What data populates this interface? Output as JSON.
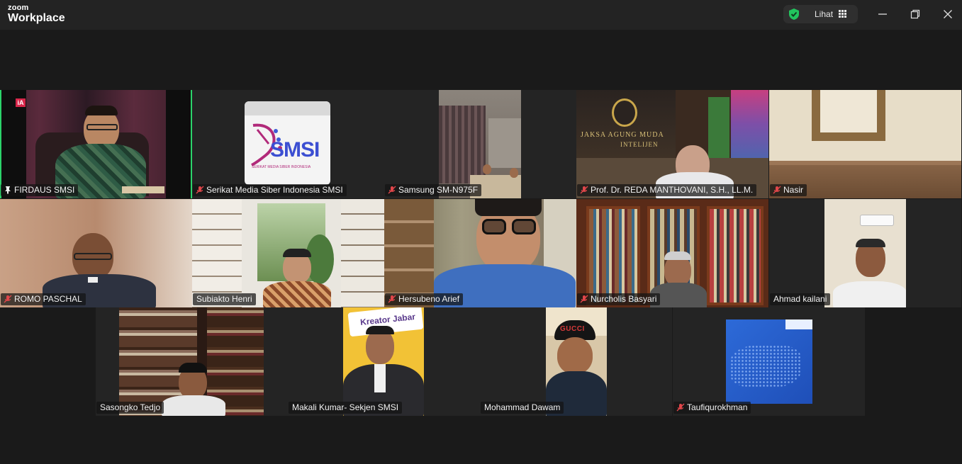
{
  "app": {
    "brand_top": "zoom",
    "brand_bottom": "Workplace"
  },
  "header": {
    "view_label": "Lihat",
    "icons": [
      "shield-check-icon",
      "grid-view-icon",
      "minimize-icon",
      "restore-icon",
      "close-icon"
    ]
  },
  "colors": {
    "active_border": "#2bd36a",
    "muted_mic": "#e0464a",
    "shield": "#22c55e",
    "background": "#1a1a1a"
  },
  "participants": [
    {
      "name": "FIRDAUS SMSI",
      "badge": "pin-icon",
      "active": true
    },
    {
      "name": "Serikat Media Siber Indonesia SMSI",
      "badge": "mic-muted-icon",
      "logo_main": "SMSI",
      "logo_sub": "SERIKAT MEDIA SIBER INDONESIA"
    },
    {
      "name": "Samsung SM-N975F",
      "badge": "mic-muted-icon"
    },
    {
      "name": "Prof. Dr. REDA MANTHOVANI, S.H., LL.M.",
      "badge": "mic-muted-icon",
      "wall_text_1": "JAKSA AGUNG MUDA",
      "wall_text_2": "INTELIJEN"
    },
    {
      "name": "Nasir",
      "badge": "mic-muted-icon"
    },
    {
      "name": "ROMO PASCHAL",
      "badge": "mic-muted-icon"
    },
    {
      "name": "Subiakto Henri",
      "badge": "none"
    },
    {
      "name": "Hersubeno Arief",
      "badge": "mic-muted-icon"
    },
    {
      "name": "Nurcholis Basyari",
      "badge": "mic-muted-icon"
    },
    {
      "name": "Ahmad kailani",
      "badge": "none"
    },
    {
      "name": "Sasongko Tedjo",
      "badge": "none"
    },
    {
      "name": "Makali Kumar- Sekjen SMSI",
      "badge": "none",
      "banner_text": "Kreator Jabar"
    },
    {
      "name": "Mohammad Dawam",
      "badge": "none",
      "cap_text": "GUCCI"
    },
    {
      "name": "Taufiqurokhman",
      "badge": "mic-muted-icon"
    }
  ]
}
